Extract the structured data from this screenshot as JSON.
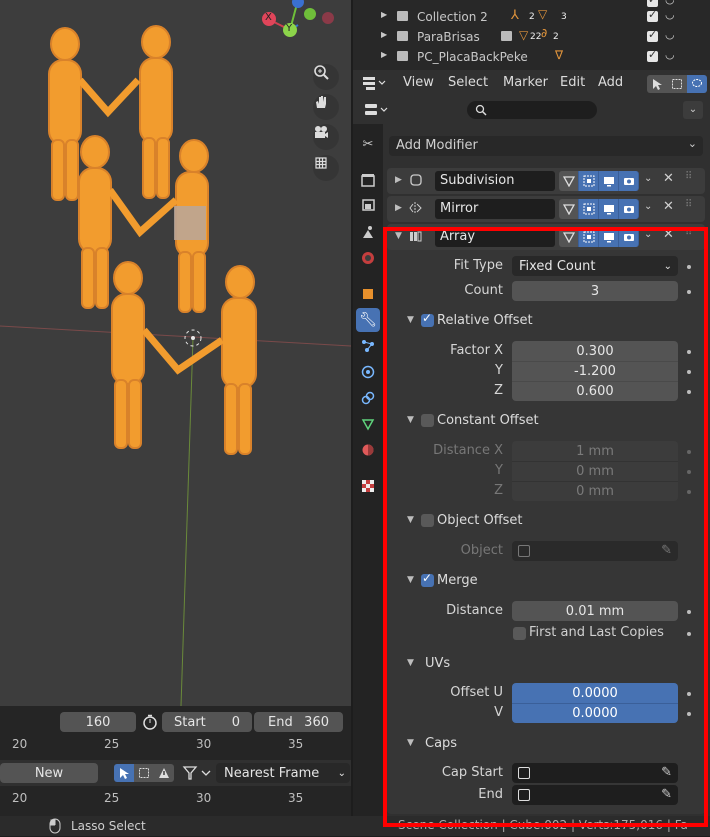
{
  "colors": {
    "accent": "#4772b3",
    "selection_orange": "#f29c2e",
    "highlight": "#ff0000"
  },
  "viewport": {
    "gizmo": {
      "x": "X",
      "y": "Y"
    },
    "tools": [
      "zoom-icon",
      "hand-icon",
      "camera-icon",
      "grid-icon"
    ]
  },
  "timeline": {
    "current_frame": "160",
    "start_label": "Start",
    "start_value": "0",
    "end_label": "End",
    "end_value": "360",
    "ruler1": [
      "20",
      "25",
      "30",
      "35"
    ],
    "new_button": "New",
    "interpolation": "Nearest Frame",
    "ruler2": [
      "20",
      "25",
      "30",
      "35"
    ]
  },
  "status": {
    "lasso": "Lasso Select",
    "info": "Scene Collection | Cube.002 | Verts:175,016 | Fa"
  },
  "outliner": {
    "rows": [
      {
        "name": "Collection 2",
        "counts": [
          "2",
          "3"
        ]
      },
      {
        "name": "ParaBrisas",
        "counts": [
          "22",
          "2"
        ]
      },
      {
        "name": "PC_PlacaBackPeke",
        "counts": []
      }
    ],
    "top_count": "3"
  },
  "nla_menu": [
    "View",
    "Select",
    "Marker",
    "Edit",
    "Add"
  ],
  "properties": {
    "search_placeholder": "",
    "add_modifier": "Add Modifier",
    "modifiers": [
      {
        "name": "Subdivision",
        "icon": "subdivision-icon"
      },
      {
        "name": "Mirror",
        "icon": "mirror-icon"
      },
      {
        "name": "Array",
        "icon": "array-icon"
      }
    ],
    "array": {
      "fit_type_label": "Fit Type",
      "fit_type_value": "Fixed Count",
      "count_label": "Count",
      "count_value": "3",
      "relative_offset": {
        "label": "Relative Offset",
        "enabled": true,
        "factor_x_label": "Factor X",
        "factor_x": "0.300",
        "y_label": "Y",
        "y": "-1.200",
        "z_label": "Z",
        "z": "0.600"
      },
      "constant_offset": {
        "label": "Constant Offset",
        "enabled": false,
        "distance_x_label": "Distance X",
        "distance_x": "1 mm",
        "y_label": "Y",
        "y": "0 mm",
        "z_label": "Z",
        "z": "0 mm"
      },
      "object_offset": {
        "label": "Object Offset",
        "enabled": false,
        "object_label": "Object"
      },
      "merge": {
        "label": "Merge",
        "enabled": true,
        "distance_label": "Distance",
        "distance": "0.01 mm",
        "first_last_label": "First and Last Copies"
      },
      "uvs": {
        "label": "UVs",
        "offset_u_label": "Offset U",
        "offset_u": "0.0000",
        "v_label": "V",
        "v": "0.0000"
      },
      "caps": {
        "label": "Caps",
        "cap_start_label": "Cap Start",
        "end_label": "End"
      }
    }
  }
}
